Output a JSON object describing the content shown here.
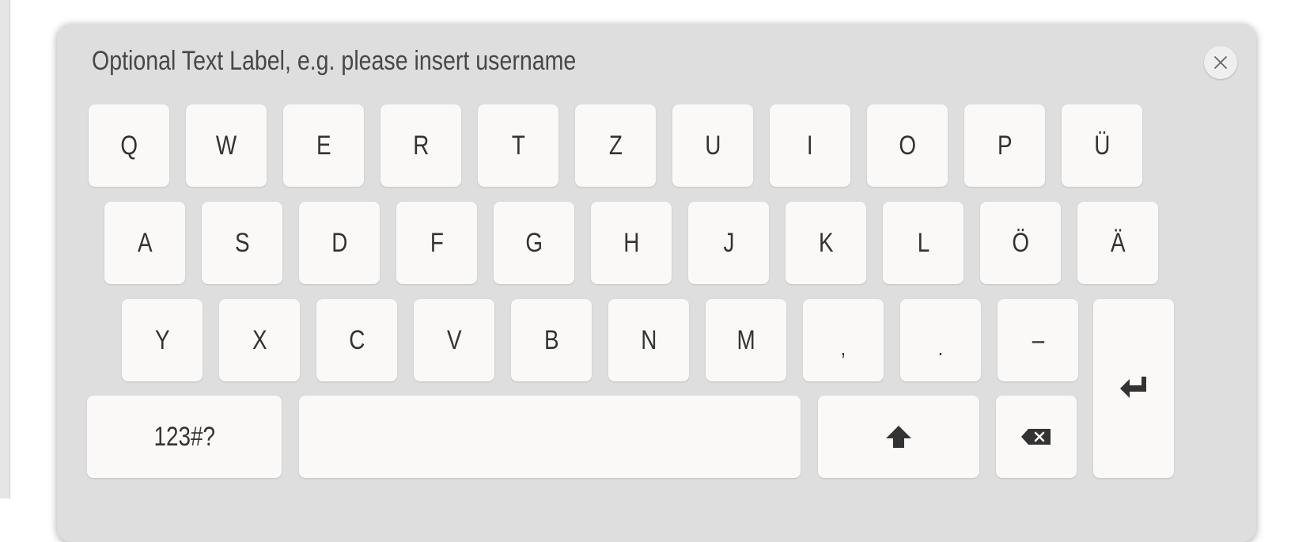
{
  "keyboard": {
    "label": "Optional Text Label, e.g. please insert username",
    "close_icon": "close-icon",
    "rows": [
      [
        "Q",
        "W",
        "E",
        "R",
        "T",
        "Z",
        "U",
        "I",
        "O",
        "P",
        "Ü"
      ],
      [
        "A",
        "S",
        "D",
        "F",
        "G",
        "H",
        "J",
        "K",
        "L",
        "Ö",
        "Ä"
      ],
      [
        "Y",
        "X",
        "C",
        "V",
        "B",
        "N",
        "M",
        ",",
        ".",
        "–"
      ]
    ],
    "mode_key_label": "123#?",
    "space_icon": "space-bar",
    "shift_icon": "shift-icon",
    "backspace_icon": "backspace-icon",
    "enter_icon": "enter-icon"
  },
  "colors": {
    "panel": "#dedede",
    "key": "#faf9f7",
    "text": "#333333"
  }
}
